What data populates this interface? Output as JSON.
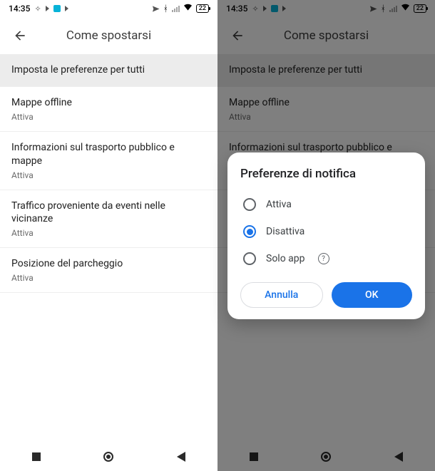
{
  "status": {
    "time": "14:35",
    "battery": "22"
  },
  "header": {
    "title": "Come spostarsi"
  },
  "list": {
    "items": [
      {
        "title": "Imposta le preferenze per tutti",
        "sub": null,
        "highlight": true
      },
      {
        "title": "Mappe offline",
        "sub": "Attiva",
        "highlight": false
      },
      {
        "title": "Informazioni sul trasporto pubblico e mappe",
        "sub": "Attiva",
        "highlight": false
      },
      {
        "title": "Traffico proveniente da eventi nelle vicinanze",
        "sub": "Attiva",
        "highlight": false
      },
      {
        "title": "Posizione del parcheggio",
        "sub": "Attiva",
        "highlight": false
      }
    ]
  },
  "dialog": {
    "title": "Preferenze di notifica",
    "options": [
      {
        "label": "Attiva",
        "checked": false,
        "help": false
      },
      {
        "label": "Disattiva",
        "checked": true,
        "help": false
      },
      {
        "label": "Solo app",
        "checked": false,
        "help": true
      }
    ],
    "cancel": "Annulla",
    "ok": "OK"
  }
}
